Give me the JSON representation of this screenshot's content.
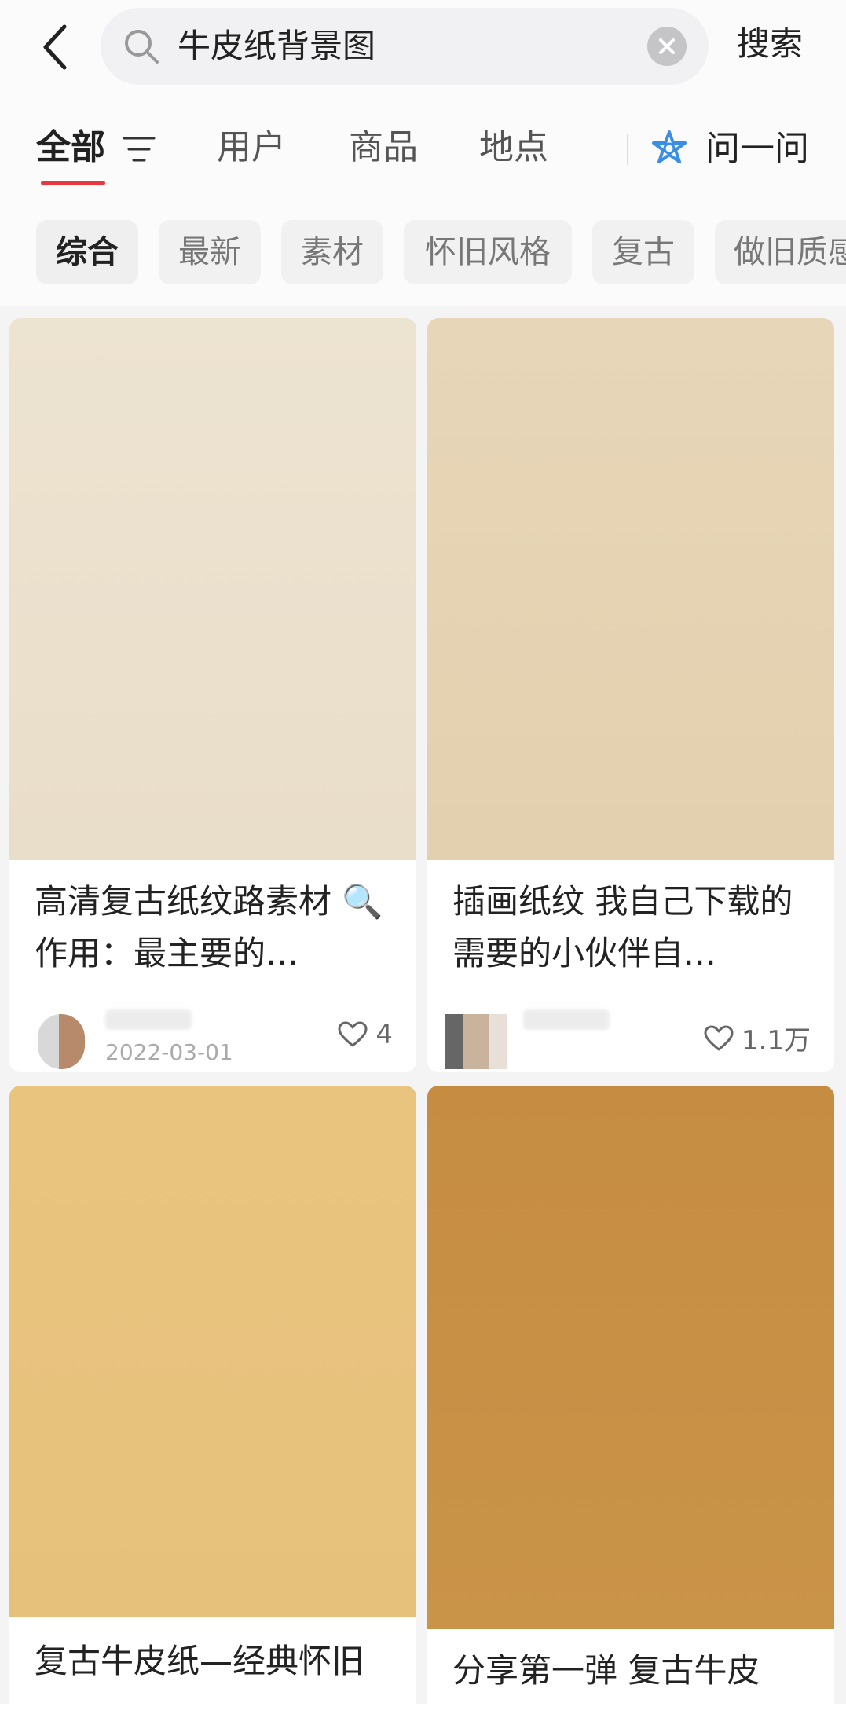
{
  "search": {
    "query": "牛皮纸背景图",
    "submit_label": "搜索"
  },
  "tabs": [
    {
      "label": "全部",
      "active": true
    },
    {
      "label": "用户"
    },
    {
      "label": "商品"
    },
    {
      "label": "地点"
    }
  ],
  "ask": {
    "label": "问一问",
    "accent": "#3a8ee6"
  },
  "filters": [
    {
      "label": "综合",
      "active": true
    },
    {
      "label": "最新"
    },
    {
      "label": "素材"
    },
    {
      "label": "怀旧风格"
    },
    {
      "label": "复古"
    },
    {
      "label": "做旧质感"
    }
  ],
  "posts": [
    {
      "title": "高清复古纸纹路素材 🔍作用：最主要的…",
      "date": "2022-03-01",
      "likes": "4",
      "image_color": "#ece2d0"
    },
    {
      "title": "插画纸纹 我自己下载的 需要的小伙伴自…",
      "likes": "1.1万",
      "image_color": "#e6d4b4"
    },
    {
      "title": "复古牛皮纸—经典怀旧",
      "image_color": "#e8c27f"
    },
    {
      "title": "分享第一弹 复古牛皮",
      "image_color": "#c88f44"
    }
  ],
  "colors": {
    "accent_red": "#e8373e",
    "background": "#f4f4f4"
  }
}
